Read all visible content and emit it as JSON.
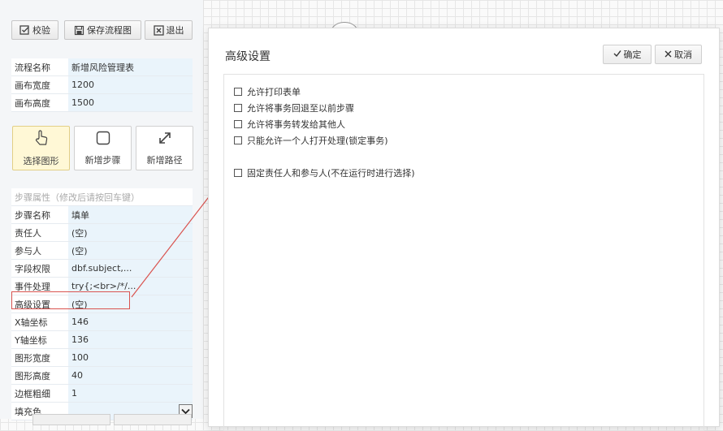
{
  "toolbar": {
    "validate_label": "校验",
    "save_label": "保存流程图",
    "exit_label": "退出"
  },
  "flow_props": [
    {
      "key": "流程名称",
      "value": "新增风险管理表"
    },
    {
      "key": "画布宽度",
      "value": "1200"
    },
    {
      "key": "画布高度",
      "value": "1500"
    }
  ],
  "tools": {
    "select_label": "选择图形",
    "add_step_label": "新增步骤",
    "add_path_label": "新增路径"
  },
  "step_props_header": "步骤属性（修改后请按回车键）",
  "step_props": [
    {
      "key": "步骤名称",
      "value": "填单"
    },
    {
      "key": "责任人",
      "value": "(空)"
    },
    {
      "key": "参与人",
      "value": "(空)"
    },
    {
      "key": "字段权限",
      "value": "dbf.subject,..."
    },
    {
      "key": "事件处理",
      "value": "try{;<br>/*/..."
    },
    {
      "key": "高级设置",
      "value": "(空)"
    },
    {
      "key": "X轴坐标",
      "value": "146"
    },
    {
      "key": "Y轴坐标",
      "value": "136"
    },
    {
      "key": "图形宽度",
      "value": "100"
    },
    {
      "key": "图形高度",
      "value": "40"
    },
    {
      "key": "边框粗细",
      "value": "1"
    }
  ],
  "fill_color": {
    "key": "填充色",
    "value": ""
  },
  "dialog": {
    "title": "高级设置",
    "confirm_label": "确定",
    "cancel_label": "取消",
    "options": [
      "允许打印表单",
      "允许将事务回退至以前步骤",
      "允许将事务转发给其他人",
      "只能允许一个人打开处理(锁定事务)",
      "固定责任人和参与人(不在运行时进行选择)"
    ]
  },
  "colors": {
    "accent_red": "#d9534f",
    "active_tool_bg": "#fff8d6",
    "value_cell_bg": "#eaf4fb"
  }
}
